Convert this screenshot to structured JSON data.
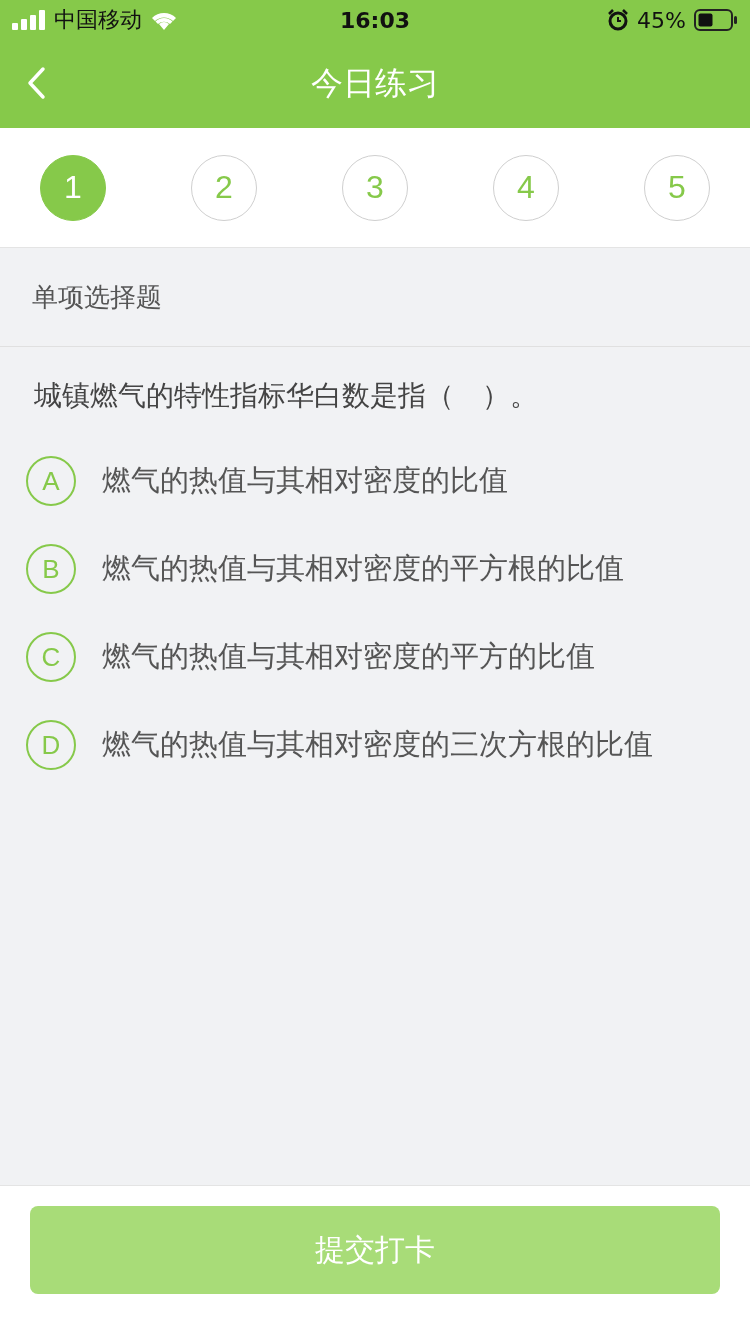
{
  "status_bar": {
    "carrier": "中国移动",
    "time": "16:03",
    "battery": "45%"
  },
  "nav": {
    "title": "今日练习"
  },
  "steps": [
    {
      "label": "1",
      "selected": true
    },
    {
      "label": "2",
      "selected": false
    },
    {
      "label": "3",
      "selected": false
    },
    {
      "label": "4",
      "selected": false
    },
    {
      "label": "5",
      "selected": false
    }
  ],
  "section": {
    "title": "单项选择题"
  },
  "question": {
    "text": "城镇燃气的特性指标华白数是指（　）。"
  },
  "options": [
    {
      "letter": "A",
      "text": "燃气的热值与其相对密度的比值",
      "selected": false
    },
    {
      "letter": "B",
      "text": "燃气的热值与其相对密度的平方根的比值",
      "selected": false
    },
    {
      "letter": "C",
      "text": "燃气的热值与其相对密度的平方的比值",
      "selected": false
    },
    {
      "letter": "D",
      "text": "燃气的热值与其相对密度的三次方根的比值",
      "selected": false
    }
  ],
  "submit": {
    "label": "提交打卡",
    "disabled": true
  }
}
